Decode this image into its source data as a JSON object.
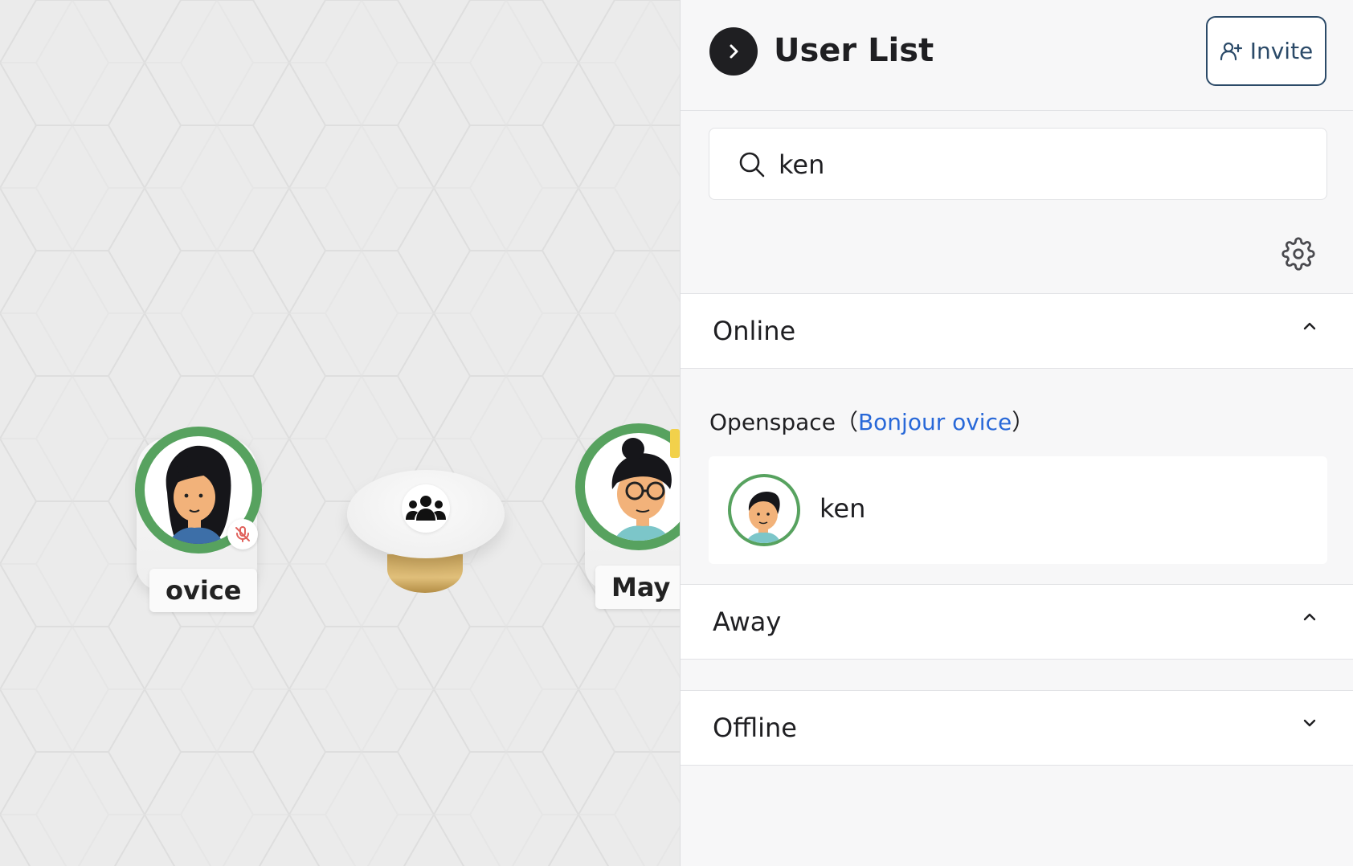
{
  "map": {
    "users": [
      {
        "name": "ovice",
        "muted": true
      },
      {
        "name": "May",
        "muted": true
      }
    ]
  },
  "sidebar": {
    "title": "User List",
    "invite_label": "Invite",
    "search": {
      "value": "ken"
    },
    "sections": {
      "online": {
        "label": "Online",
        "expanded": true
      },
      "away": {
        "label": "Away",
        "expanded": true
      },
      "offline": {
        "label": "Offline",
        "expanded": false
      }
    },
    "room": {
      "name": "Openspace",
      "open_paren": "（",
      "link_text": "Bonjour ovice",
      "close_paren": "）"
    },
    "online_users": [
      {
        "name": "ken"
      }
    ]
  },
  "colors": {
    "status_ring": "#57a25f",
    "link": "#2868d8",
    "invite_border": "#2b4a68",
    "mute": "#e0605a"
  }
}
